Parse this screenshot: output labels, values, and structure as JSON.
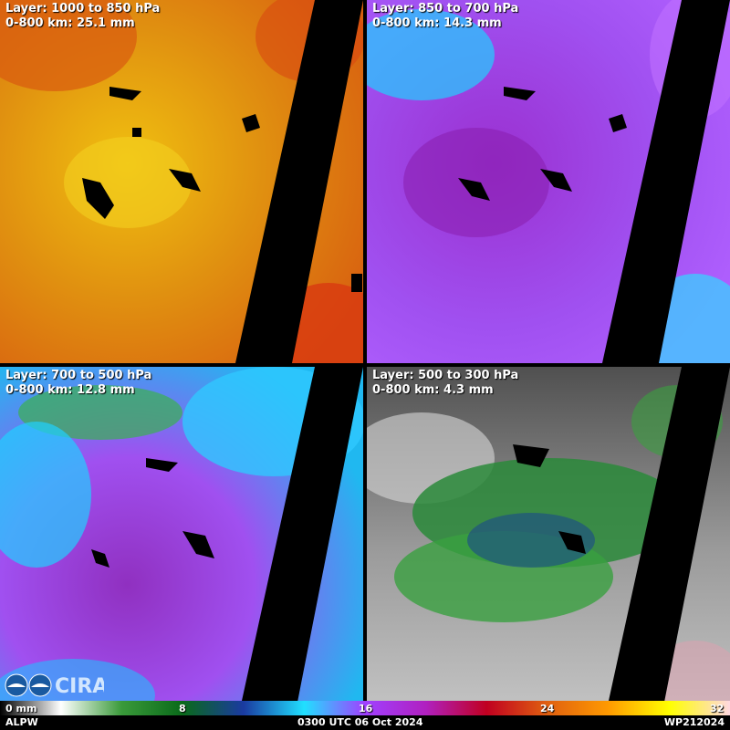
{
  "panels": [
    {
      "layer": "Layer: 1000 to 850 hPa",
      "stat": "0-800 km: 25.1 mm"
    },
    {
      "layer": "Layer: 850 to 700 hPa",
      "stat": "0-800 km: 14.3 mm"
    },
    {
      "layer": "Layer: 700 to 500 hPa",
      "stat": "0-800 km: 12.8 mm"
    },
    {
      "layer": "Layer: 500 to 300 hPa",
      "stat": "0-800 km: 4.3 mm"
    }
  ],
  "colorbar": {
    "ticks": [
      "0 mm",
      "8",
      "16",
      "24",
      "32"
    ],
    "stops": [
      "#000000",
      "#ffffff",
      "#3a9a3a",
      "#0a6a1a",
      "#1a3aa0",
      "#20e0ff",
      "#a040ff",
      "#b020c0",
      "#c00020",
      "#e06010",
      "#ff9a00",
      "#ffff00",
      "#ffd8e0"
    ]
  },
  "footer": {
    "product": "ALPW",
    "time": "0300 UTC 06 Oct 2024",
    "storm_id": "WP212024"
  },
  "logo": "CIRA"
}
